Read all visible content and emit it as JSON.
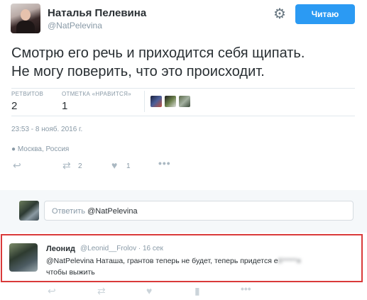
{
  "author": {
    "name": "Наталья Пелевина",
    "handle": "@NatPelevina",
    "follow_label": "Читаю",
    "gear_icon": "gear-icon"
  },
  "tweet": {
    "text_line1": "Смотрю его речь и приходится себя щипать.",
    "text_line2": "Не могу поверить, что это происходит.",
    "retweets_label": "РЕТВИТОВ",
    "retweets_count": "2",
    "likes_label": "ОТМЕТКА «НРАВИТСЯ»",
    "likes_count": "1",
    "timestamp": "23:53 - 8 нояб. 2016 г.",
    "location": "Москва, Россия"
  },
  "actions": {
    "retweet_count": "2",
    "like_count": "1"
  },
  "reply_box": {
    "prefix": "Ответить",
    "mention": "@NatPelevina"
  },
  "reply": {
    "name": "Леонид",
    "handle": "@Leonid__Frolov",
    "time": "· 16 сек",
    "text_before_blur": "@NatPelevina Наташа, грантов теперь не будет, теперь придется е",
    "text_blurred": "б*****я",
    "text_line2": "чтобы выжить"
  },
  "colors": {
    "accent": "#2b9af3",
    "highlight_border": "#d93a3a",
    "muted": "#8899a6"
  }
}
